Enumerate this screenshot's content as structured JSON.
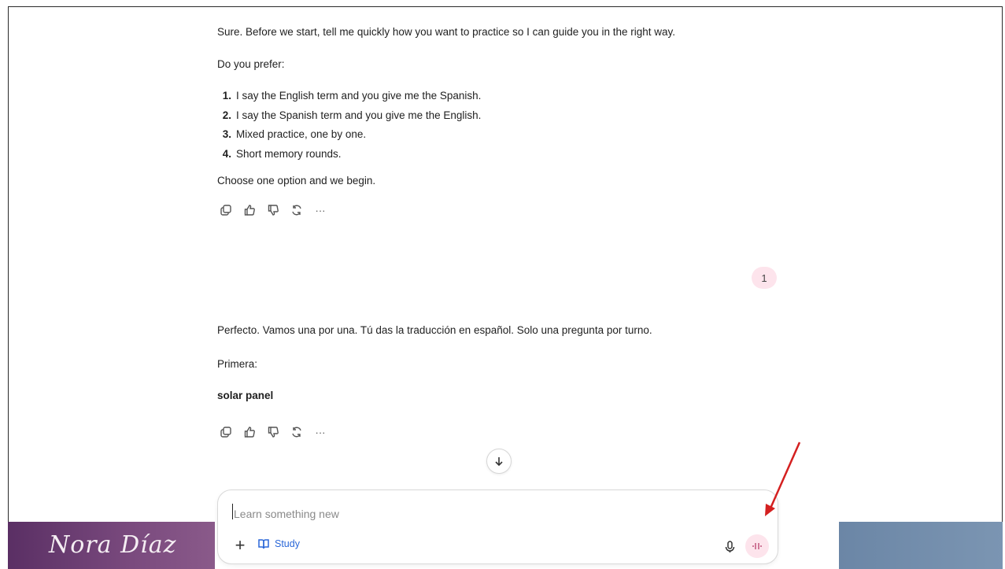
{
  "conversation": {
    "assistant_msg1": {
      "intro": "Sure. Before we start, tell me quickly how you want to practice so I can guide you in the right way.",
      "prompt": "Do you prefer:",
      "options": [
        {
          "num": "1.",
          "text": "I say the English term and you give me the Spanish."
        },
        {
          "num": "2.",
          "text": "I say the Spanish term and you give me the English."
        },
        {
          "num": "3.",
          "text": "Mixed practice, one by one."
        },
        {
          "num": "4.",
          "text": "Short memory rounds."
        }
      ],
      "closing": "Choose one option and we begin."
    },
    "user_msg": "1",
    "assistant_msg2": {
      "line1": "Perfecto. Vamos una por una. Tú das la traducción en español. Solo una pregunta por turno.",
      "line2": "Primera:",
      "term": "solar panel"
    },
    "action_icons": [
      "copy-icon",
      "thumbs-up-icon",
      "thumbs-down-icon",
      "regenerate-icon",
      "more-icon"
    ],
    "more_label": "···"
  },
  "composer": {
    "placeholder": "Learn something new",
    "plus_label": "+",
    "study_label": "Study"
  },
  "branding": {
    "signature": "Nora Díaz",
    "left_color": "#5a2f64",
    "right_color": "#6b86a6"
  },
  "colors": {
    "accent_blue": "#2a67d8",
    "pink_bg": "#fde4ec",
    "annotation_arrow": "#d42020"
  }
}
